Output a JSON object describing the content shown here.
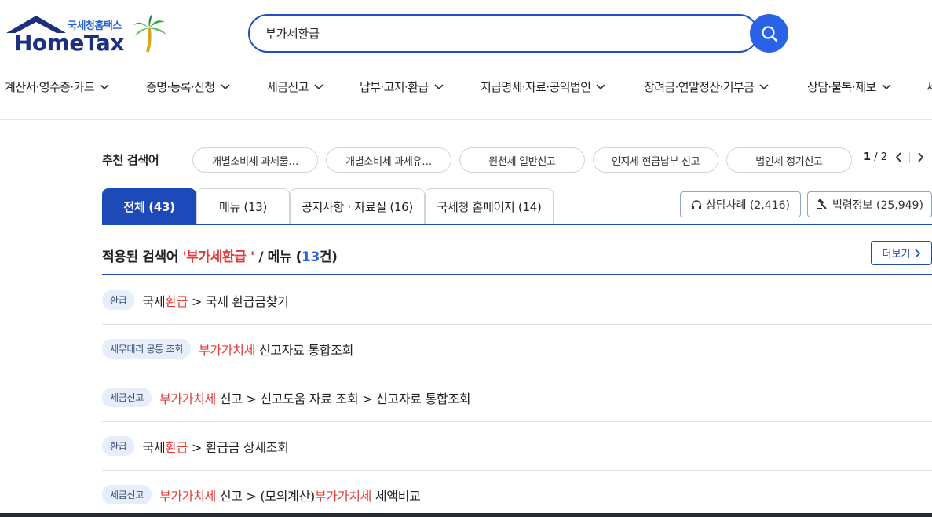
{
  "logo": {
    "sub": "국세청홈택스",
    "main": "HomeTax"
  },
  "search": {
    "value": "부가세환급"
  },
  "gnb": [
    {
      "label": "계산서·영수증·카드"
    },
    {
      "label": "증명·등록·신청"
    },
    {
      "label": "세금신고"
    },
    {
      "label": "납부·고지·환급"
    },
    {
      "label": "지급명세·자료·공익법인"
    },
    {
      "label": "장려금·연말정산·기부금"
    },
    {
      "label": "상담·불복·제보"
    },
    {
      "label": "세"
    }
  ],
  "recommended": {
    "title": "추천 검색어",
    "chips": [
      {
        "label": "개별소비세 과세물…"
      },
      {
        "label": "개별소비세 과세유…"
      },
      {
        "label": "원천세 일반신고"
      },
      {
        "label": "인지세 현금납부 신고"
      },
      {
        "label": "법인세 정기신고"
      }
    ],
    "page_current": "1",
    "page_total": "/ 2"
  },
  "tabs": [
    {
      "label": "전체 (43)",
      "active": true
    },
    {
      "label": "메뉴 (13)",
      "active": false
    },
    {
      "label": "공지사항 · 자료실 (16)",
      "active": false
    },
    {
      "label": "국세청 홈페이지 (14)",
      "active": false
    }
  ],
  "side_buttons": {
    "consult": "상담사례 (2,416)",
    "law": "법령정보 (25,949)"
  },
  "result_head": {
    "prefix": "적용된 검색어 ",
    "term": "'부가세환급 '",
    "middle": " / 메뉴 (",
    "count": "13",
    "suffix": "건)"
  },
  "more_label": "더보기",
  "rows": [
    {
      "badge": "환급",
      "parts": [
        {
          "t": "국세"
        },
        {
          "t": "환급",
          "hl": true
        },
        {
          "t": " > 국세 환급금찾기"
        }
      ]
    },
    {
      "badge": "세무대리 공통 조회",
      "parts": [
        {
          "t": "부가가치세",
          "hl": true
        },
        {
          "t": " 신고자료 통합조회"
        }
      ]
    },
    {
      "badge": "세금신고",
      "parts": [
        {
          "t": "부가가치세",
          "hl": true
        },
        {
          "t": " 신고 > 신고도움 자료 조회 > 신고자료 통합조회"
        }
      ]
    },
    {
      "badge": "환급",
      "parts": [
        {
          "t": "국세"
        },
        {
          "t": "환급",
          "hl": true
        },
        {
          "t": " > 환급금 상세조회"
        }
      ]
    },
    {
      "badge": "세금신고",
      "parts": [
        {
          "t": "부가가치세",
          "hl": true
        },
        {
          "t": " 신고 > (모의계산)"
        },
        {
          "t": "부가가치세",
          "hl": true
        },
        {
          "t": " 세액비교"
        }
      ]
    }
  ],
  "colors": {
    "brand_blue": "#1e49b8",
    "highlight_red": "#e23b3b",
    "count_blue": "#2a62e8"
  }
}
